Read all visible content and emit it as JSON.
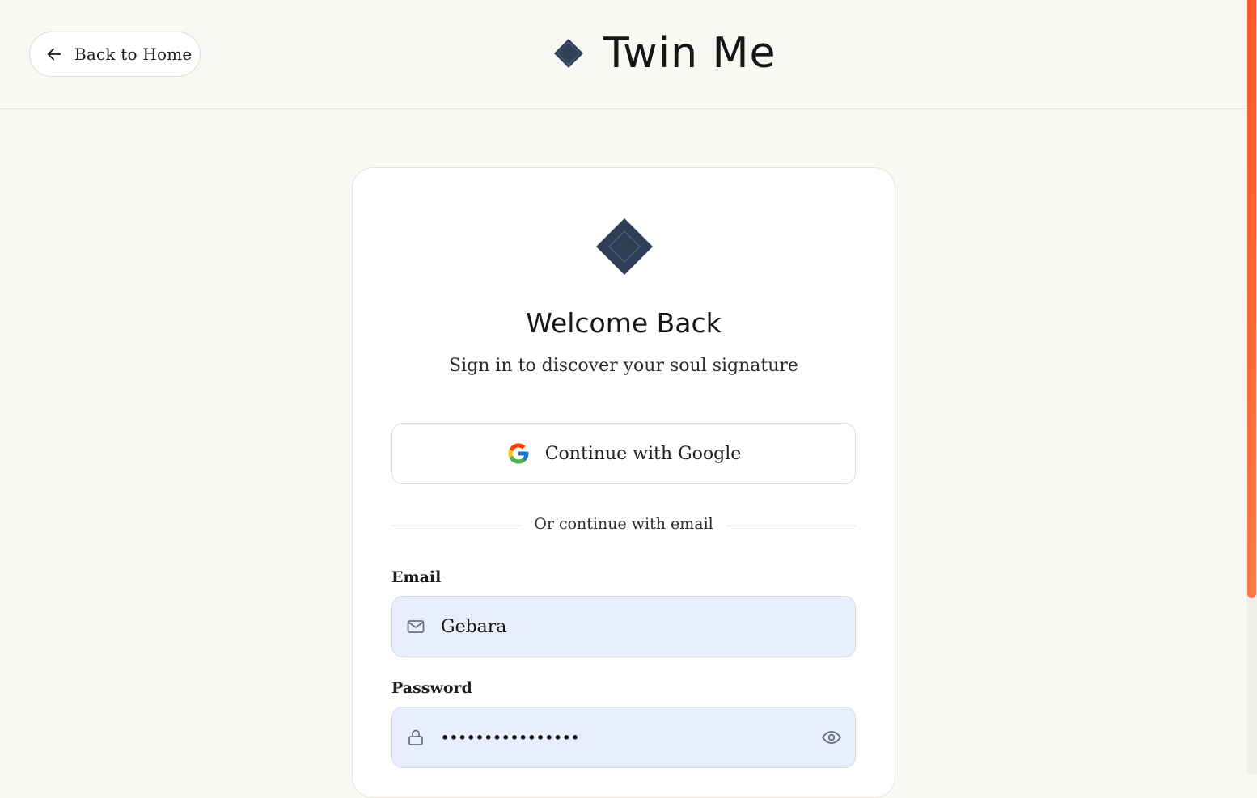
{
  "header": {
    "back_label": "Back to Home",
    "brand_name": "Twin Me"
  },
  "card": {
    "title": "Welcome Back",
    "subtitle": "Sign in to discover your soul signature",
    "google_label": "Continue with Google",
    "divider_text": "Or continue with email",
    "email": {
      "label": "Email",
      "value": "Gebara"
    },
    "password": {
      "label": "Password",
      "value": "••••••••••••••••"
    }
  },
  "icons": {
    "back": "arrow-left-icon",
    "brand": "diamond-logo-icon",
    "google": "google-icon",
    "email": "mail-icon",
    "password": "lock-icon",
    "reveal": "eye-icon"
  },
  "colors": {
    "page_bg": "#f9f8f5",
    "logo_fill": "#2d3e55",
    "input_bg": "#e8eefb",
    "scroll_thumb": "#ff5a2a"
  }
}
